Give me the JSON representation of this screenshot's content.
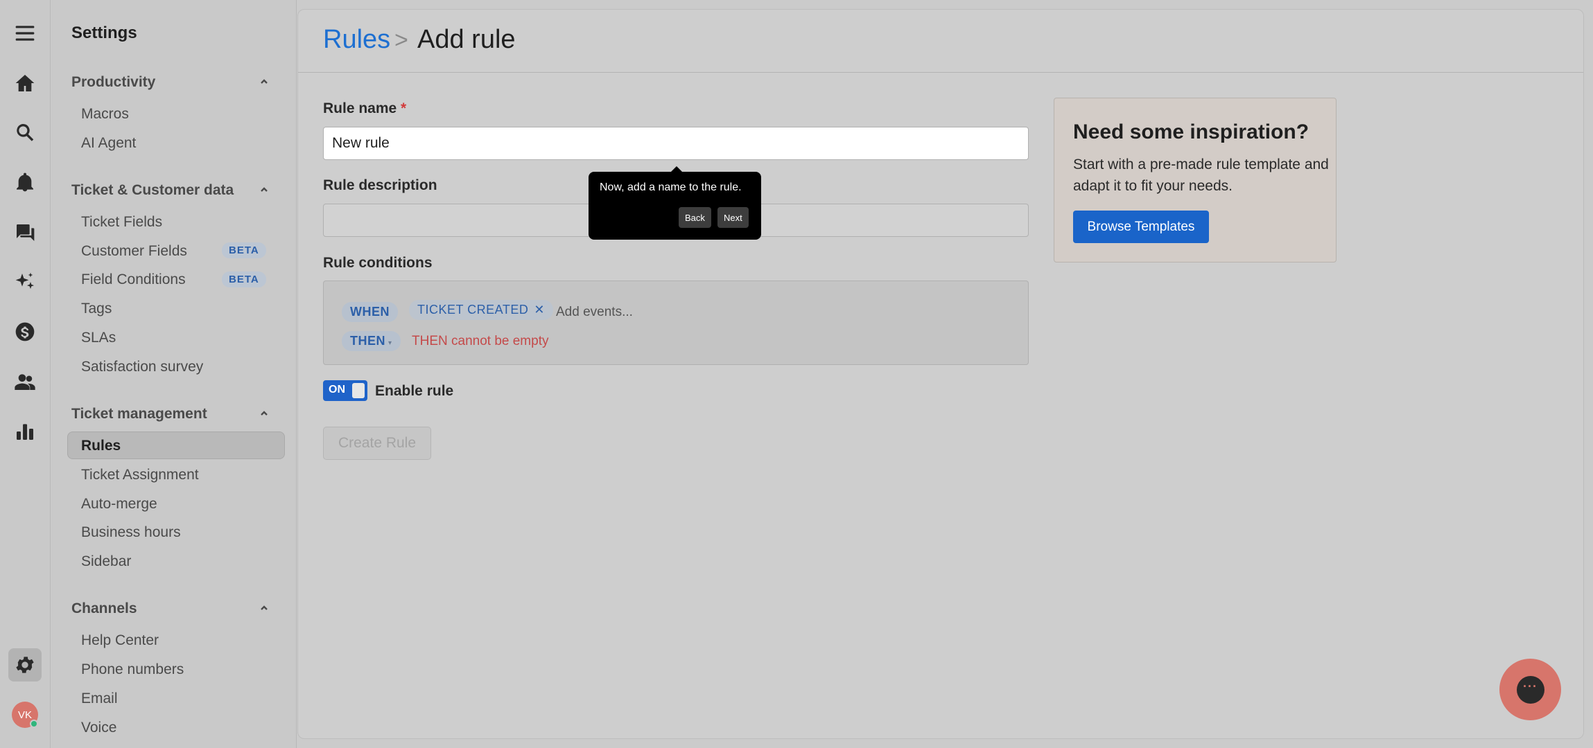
{
  "nav": {
    "title": "Settings",
    "sections": [
      {
        "title": "Productivity",
        "items": [
          "Macros",
          "AI Agent"
        ]
      },
      {
        "title": "Ticket & Customer data",
        "items": [
          "Ticket Fields",
          "Customer Fields",
          "Field Conditions",
          "Tags",
          "SLAs",
          "Satisfaction survey"
        ]
      },
      {
        "title": "Ticket management",
        "items": [
          "Rules",
          "Ticket Assignment",
          "Auto-merge",
          "Business hours",
          "Sidebar"
        ]
      },
      {
        "title": "Channels",
        "items": [
          "Help Center",
          "Phone numbers",
          "Email",
          "Voice"
        ]
      }
    ],
    "beta_label": "BETA",
    "active_item": "Rules"
  },
  "user": {
    "initials": "VK"
  },
  "header": {
    "crumb_root": "Rules",
    "crumb_sep": ">",
    "crumb_current": "Add rule"
  },
  "form": {
    "name_label": "Rule name",
    "required_mark": "*",
    "name_value": "New rule",
    "description_label": "Rule description",
    "description_value": "",
    "conditions_label": "Rule conditions",
    "when_label": "WHEN",
    "event_tag": "TICKET CREATED",
    "event_remove": "✕",
    "add_events_placeholder": "Add events...",
    "then_label": "THEN",
    "then_caret": "▾",
    "then_error": "THEN cannot be empty",
    "toggle_label": "ON",
    "enable_label": "Enable rule",
    "create_button": "Create Rule"
  },
  "inspiration": {
    "title": "Need some inspiration?",
    "text": "Start with a pre-made rule template and adapt it to fit your needs.",
    "button": "Browse Templates"
  },
  "tooltip": {
    "text": "Now, add a name to the rule.",
    "back": "Back",
    "next": "Next"
  },
  "chat": {
    "dots": "···"
  }
}
